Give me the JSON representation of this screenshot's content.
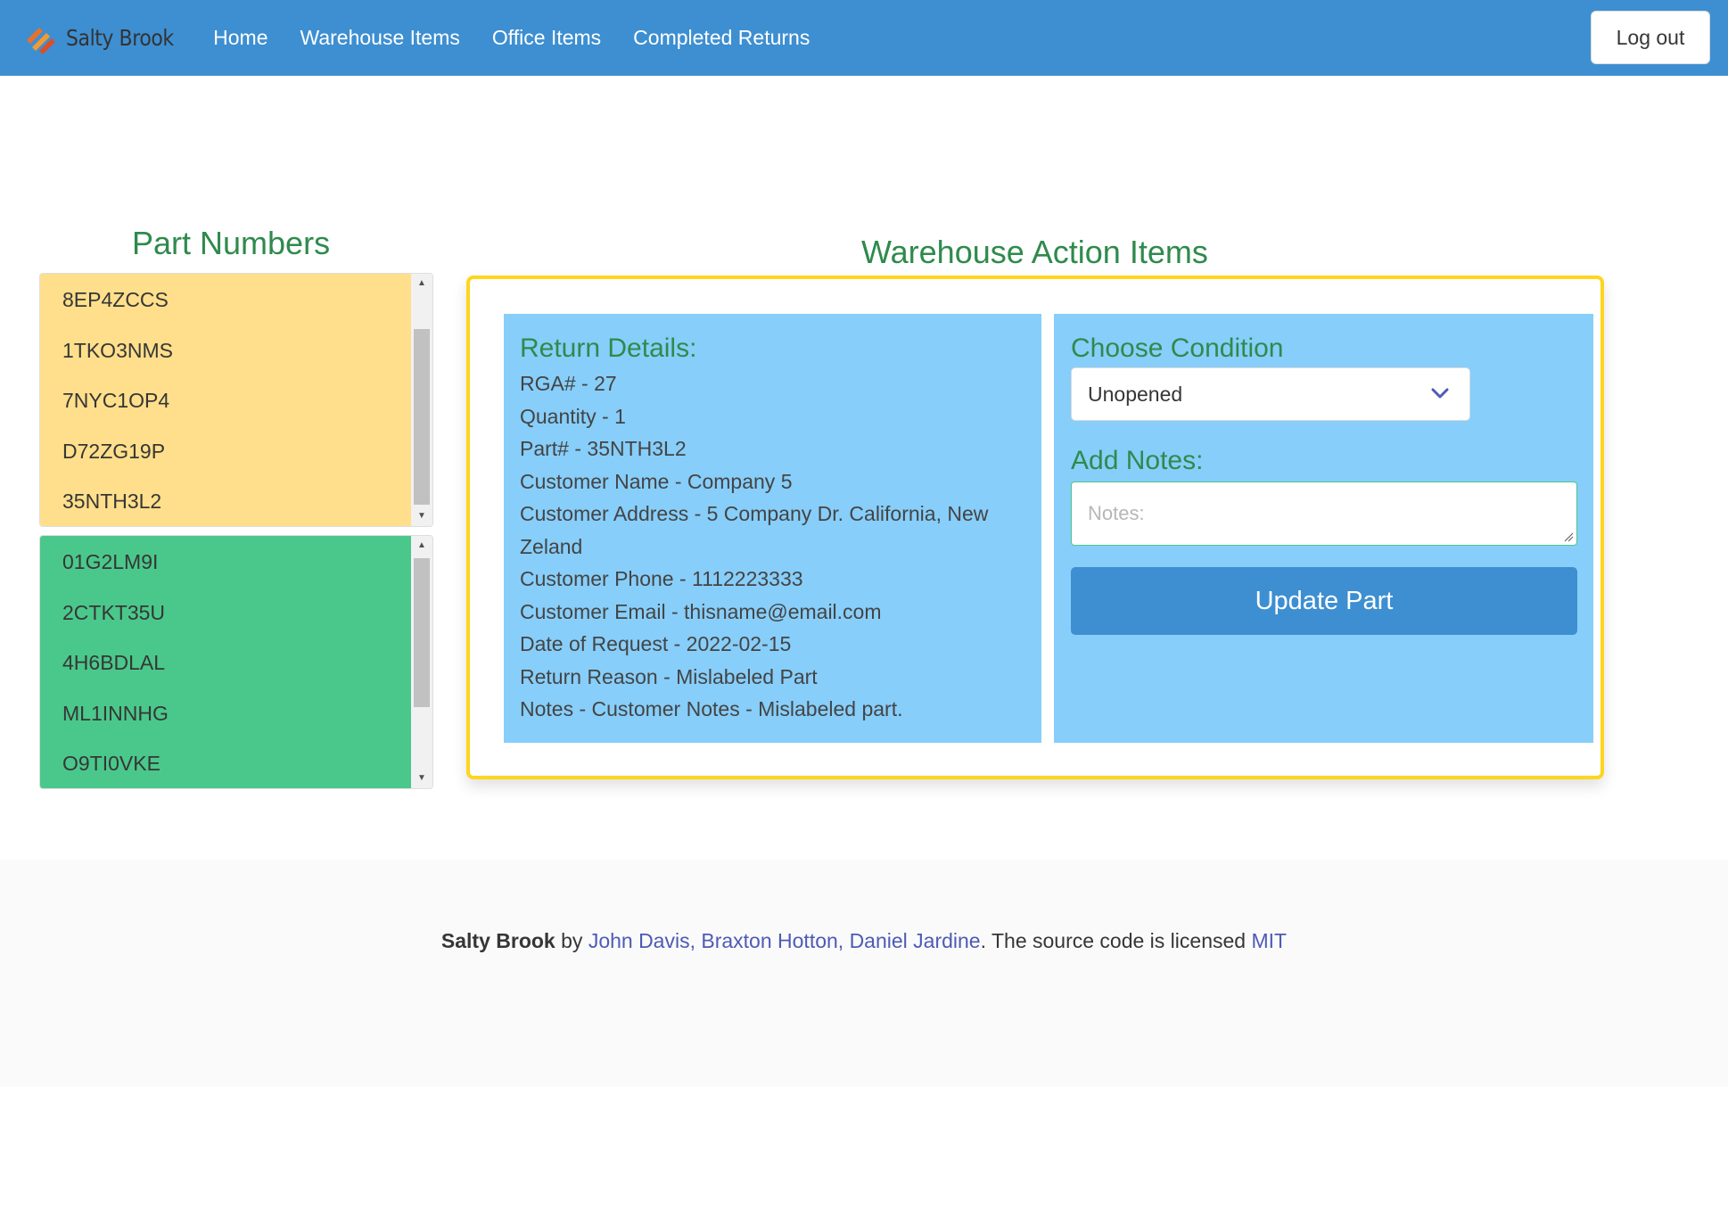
{
  "nav": {
    "brand": "Salty Brook",
    "items": [
      "Home",
      "Warehouse Items",
      "Office Items",
      "Completed Returns"
    ],
    "logout_label": "Log out"
  },
  "part_numbers": {
    "title": "Part Numbers",
    "pending_items": [
      "8EP4ZCCS",
      "1TKO3NMS",
      "7NYC1OP4",
      "D72ZG19P",
      "35NTH3L2"
    ],
    "completed_items": [
      "01G2LM9I",
      "2CTKT35U",
      "4H6BDLAL",
      "ML1INNHG",
      "O9TI0VKE"
    ]
  },
  "action": {
    "title": "Warehouse Action Items",
    "details_title": "Return Details:",
    "details": [
      "RGA# - 27",
      "Quantity - 1",
      "Part# - 35NTH3L2",
      "Customer Name - Company 5",
      "Customer Address - 5 Company Dr. California, New Zeland",
      "Customer Phone - 1112223333",
      "Customer Email - thisname@email.com",
      "Date of Request - 2022-02-15",
      "Return Reason - Mislabeled Part",
      "Notes - Customer Notes - Mislabeled part."
    ],
    "condition_title": "Choose Condition",
    "condition_value": "Unopened",
    "notes_title": "Add Notes:",
    "notes_placeholder": "Notes:",
    "update_label": "Update Part"
  },
  "footer": {
    "brand": "Salty Brook",
    "by": " by ",
    "authors": "John Davis, Braxton Hotton, Daniel Jardine",
    "license_text": ". The source code is licensed ",
    "license": "MIT"
  },
  "colors": {
    "navbar": "#3d8fd1",
    "heading_green": "#2f8a4c",
    "pending_yellow": "#ffdf8b",
    "completed_green": "#4ac88b",
    "panel_blue": "#87cefa",
    "frame_yellow": "#ffd51d"
  }
}
